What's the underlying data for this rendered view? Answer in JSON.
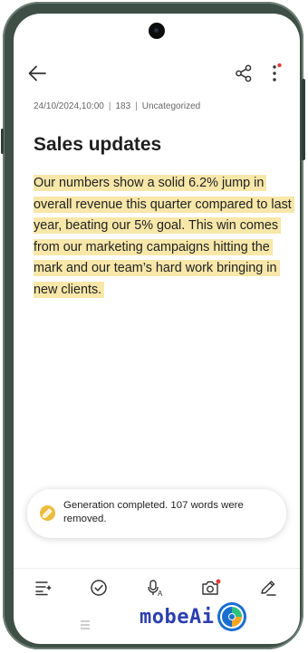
{
  "note": {
    "date": "24/10/2024,10:00",
    "word_count": "183",
    "category": "Uncategorized",
    "title": "Sales updates",
    "body": "Our numbers show a solid 6.2% jump in overall revenue this quarter compared to last year, beating our 5% goal. This win comes from our marketing campaigns hitting the mark and our team’s hard work bringing in new clients."
  },
  "header": {
    "icons": [
      "back-arrow-icon",
      "share-icon",
      "more-vertical-icon"
    ]
  },
  "toast": {
    "message": "Generation completed. 107 words were removed."
  },
  "bottom_toolbar": {
    "icons": [
      "text-style-icon",
      "checklist-icon",
      "voice-recording-icon",
      "camera-icon",
      "pen-icon"
    ]
  },
  "watermark": {
    "text": "mobeAi"
  },
  "colors": {
    "highlight": "#f7e7a9",
    "notification_dot": "#e53935",
    "toast_icon": "#ecbc3b",
    "frame": "#3e4f48"
  }
}
